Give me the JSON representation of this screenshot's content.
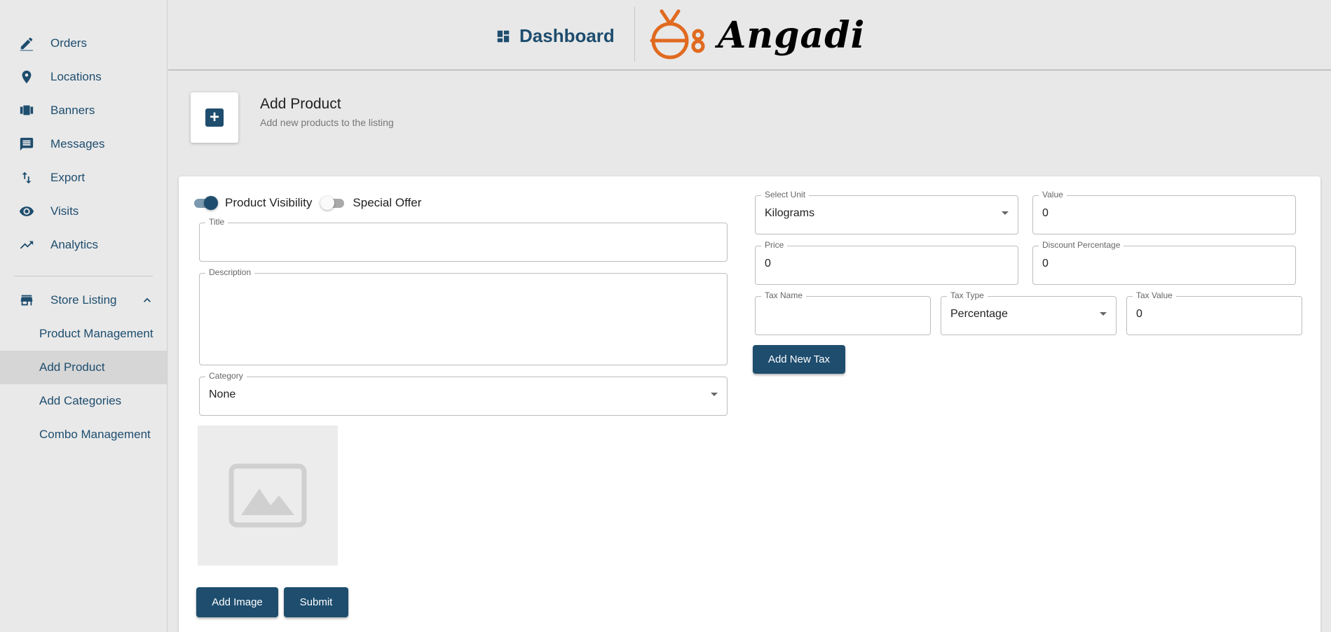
{
  "sidebar": {
    "items": [
      {
        "label": "Orders",
        "icon": "edit-icon"
      },
      {
        "label": "Locations",
        "icon": "location-pin-icon"
      },
      {
        "label": "Banners",
        "icon": "carousel-icon"
      },
      {
        "label": "Messages",
        "icon": "message-icon"
      },
      {
        "label": "Export",
        "icon": "swap-vertical-icon"
      },
      {
        "label": "Visits",
        "icon": "eye-icon"
      },
      {
        "label": "Analytics",
        "icon": "trending-up-icon"
      }
    ],
    "group": {
      "label": "Store Listing",
      "icon": "store-icon",
      "expanded": true
    },
    "sub_items": [
      {
        "label": "Product Management",
        "active": false
      },
      {
        "label": "Add Product",
        "active": true
      },
      {
        "label": "Add Categories",
        "active": false
      },
      {
        "label": "Combo Management",
        "active": false
      }
    ]
  },
  "header": {
    "dashboard_label": "Dashboard",
    "brand_name": "Angadi",
    "brand_color": "#e06a1f"
  },
  "page": {
    "title": "Add Product",
    "subtitle": "Add new products to the listing"
  },
  "form": {
    "product_visibility": {
      "label": "Product Visibility",
      "on": true
    },
    "special_offer": {
      "label": "Special Offer",
      "on": false
    },
    "title": {
      "label": "Title",
      "value": ""
    },
    "description": {
      "label": "Description",
      "value": ""
    },
    "category": {
      "label": "Category",
      "value": "None"
    },
    "add_image_label": "Add Image",
    "submit_label": "Submit",
    "select_unit": {
      "label": "Select Unit",
      "value": "Kilograms"
    },
    "value": {
      "label": "Value",
      "value": "0"
    },
    "price": {
      "label": "Price",
      "value": "0"
    },
    "discount_percentage": {
      "label": "Discount Percentage",
      "value": "0"
    },
    "tax_name": {
      "label": "Tax Name",
      "value": ""
    },
    "tax_type": {
      "label": "Tax Type",
      "value": "Percentage"
    },
    "tax_value": {
      "label": "Tax Value",
      "value": "0"
    },
    "add_new_tax_label": "Add New Tax"
  },
  "colors": {
    "primary": "#1e4d6e",
    "background": "#e8e8e8"
  }
}
